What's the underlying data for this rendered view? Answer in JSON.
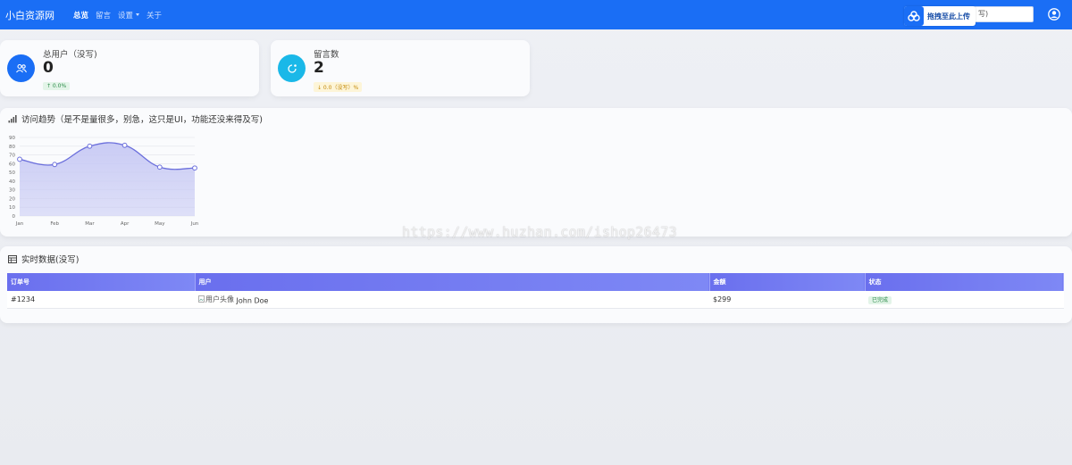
{
  "nav": {
    "brand": "小白资源网",
    "items": [
      {
        "label": "总览",
        "active": true
      },
      {
        "label": "留言",
        "active": false
      },
      {
        "label": "设置",
        "active": false,
        "dropdown": true
      },
      {
        "label": "关于",
        "active": false
      }
    ],
    "search_value": "写)",
    "upload_label": "拖拽至此上传"
  },
  "stats": [
    {
      "title": "总用户（没写)",
      "value": "0",
      "badge": "↑ 0.0%",
      "color": "#1a6ef5"
    },
    {
      "title": "留言数",
      "value": "2",
      "badge": "↓ 0.0（没写）%",
      "color": "#1ab8e8"
    }
  ],
  "chart_panel": {
    "title": "访问趋势（是不是量很多，别急，这只是UI，功能还没来得及写)"
  },
  "chart_data": {
    "type": "area",
    "categories": [
      "Jan",
      "Feb",
      "Mar",
      "Apr",
      "May",
      "Jun"
    ],
    "values": [
      65,
      59,
      80,
      81,
      56,
      55
    ],
    "ylim": [
      0,
      90
    ],
    "yticks": [
      0,
      10,
      20,
      30,
      40,
      50,
      60,
      70,
      80,
      90
    ],
    "grid": true,
    "colors": {
      "line": "#6b6fdc",
      "fill": "#c7c9f4"
    }
  },
  "table_panel": {
    "title": "实时数据(没写)",
    "columns": [
      "订单号",
      "用户",
      "金额",
      "状态"
    ],
    "rows": [
      {
        "order": "#1234",
        "avatar_alt": "用户头像",
        "user": "John Doe",
        "amount": "$299",
        "status": "已完成"
      }
    ]
  },
  "watermark": "https://www.huzhan.com/ishop26473"
}
